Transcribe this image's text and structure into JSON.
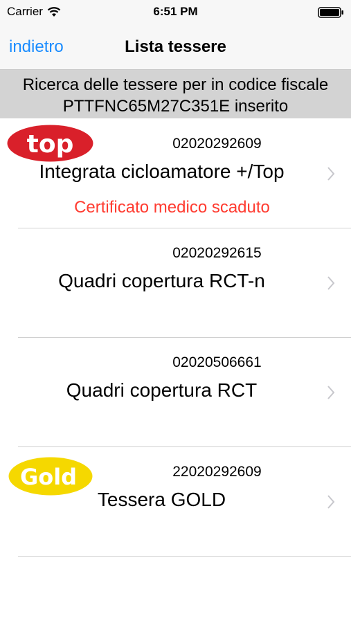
{
  "status_bar": {
    "carrier": "Carrier",
    "time": "6:51 PM"
  },
  "nav": {
    "back_label": "indietro",
    "title": "Lista tessere"
  },
  "search_header": {
    "line1": "Ricerca delle tessere per in codice fiscale",
    "line2": "PTTFNC65M27C351E inserito"
  },
  "cards": [
    {
      "code": "02020292609",
      "name": "Integrata cicloamatore +/Top",
      "warning": "Certificato medico scaduto",
      "badge": "top"
    },
    {
      "code": "02020292615",
      "name": "Quadri copertura RCT-n",
      "warning": "",
      "badge": ""
    },
    {
      "code": "02020506661",
      "name": "Quadri copertura RCT",
      "warning": "",
      "badge": ""
    },
    {
      "code": "22020292609",
      "name": "Tessera GOLD",
      "warning": "",
      "badge": "Gold"
    }
  ],
  "colors": {
    "accent": "#1a8cff",
    "warning": "#ff3b30",
    "header_bg": "#d3d3d3",
    "top_badge": "#d9202a",
    "gold_badge": "#f5d800"
  }
}
